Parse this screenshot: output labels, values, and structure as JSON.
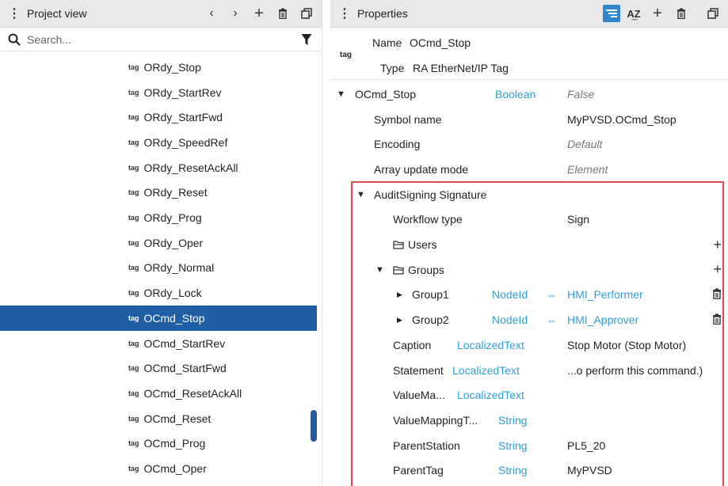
{
  "left_panel": {
    "title": "Project view",
    "search_placeholder": "Search...",
    "items": [
      {
        "icon": "tag",
        "label": "ORdy_Stop"
      },
      {
        "icon": "tag",
        "label": "ORdy_StartRev"
      },
      {
        "icon": "tag",
        "label": "ORdy_StartFwd"
      },
      {
        "icon": "tag",
        "label": "ORdy_SpeedRef"
      },
      {
        "icon": "tag",
        "label": "ORdy_ResetAckAll"
      },
      {
        "icon": "tag",
        "label": "ORdy_Reset"
      },
      {
        "icon": "tag",
        "label": "ORdy_Prog"
      },
      {
        "icon": "tag",
        "label": "ORdy_Oper"
      },
      {
        "icon": "tag",
        "label": "ORdy_Normal"
      },
      {
        "icon": "tag",
        "label": "ORdy_Lock"
      },
      {
        "icon": "tag",
        "label": "OCmd_Stop"
      },
      {
        "icon": "tag",
        "label": "OCmd_StartRev"
      },
      {
        "icon": "tag",
        "label": "OCmd_StartFwd"
      },
      {
        "icon": "tag",
        "label": "OCmd_ResetAckAll"
      },
      {
        "icon": "tag",
        "label": "OCmd_Reset"
      },
      {
        "icon": "tag",
        "label": "OCmd_Prog"
      },
      {
        "icon": "tag",
        "label": "OCmd_Oper"
      }
    ]
  },
  "right_panel": {
    "title": "Properties",
    "header": {
      "icon": "tag",
      "name_label": "Name",
      "name_value": "OCmd_Stop",
      "type_label": "Type",
      "type_value": "RA EtherNet/IP Tag"
    },
    "rows": [
      {
        "name": "OCmd_Stop",
        "type": "Boolean",
        "value": "False"
      },
      {
        "name": "Symbol name",
        "value": "MyPVSD.OCmd_Stop"
      },
      {
        "name": "Encoding",
        "value": "Default"
      },
      {
        "name": "Array update mode",
        "value": "Element"
      },
      {
        "name": "AuditSigning Signature"
      },
      {
        "name": "Workflow type",
        "value": "Sign"
      },
      {
        "name": "Users"
      },
      {
        "name": "Groups"
      },
      {
        "name": "Group1",
        "type": "NodeId",
        "value": "HMI_Performer"
      },
      {
        "name": "Group2",
        "type": "NodeId",
        "value": "HMI_Approver"
      },
      {
        "name": "Caption",
        "type": "LocalizedText",
        "value": "Stop Motor (Stop Motor)"
      },
      {
        "name": "Statement",
        "type": "LocalizedText",
        "value": "...o perform this command.)"
      },
      {
        "name": "ValueMa...",
        "type": "LocalizedText"
      },
      {
        "name": "ValueMappingT...",
        "type": "String"
      },
      {
        "name": "ParentStation",
        "type": "String",
        "value": "PL5_20"
      },
      {
        "name": "ParentTag",
        "type": "String",
        "value": "MyPVSD"
      }
    ]
  }
}
